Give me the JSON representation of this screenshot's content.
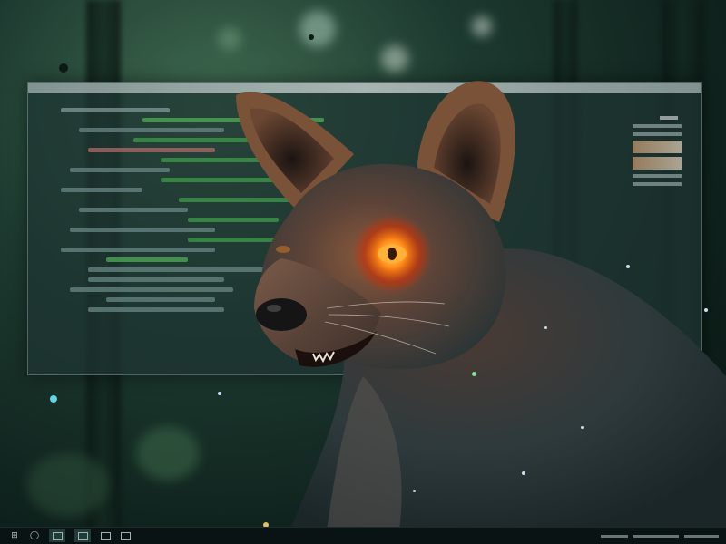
{
  "scene": {
    "subject": "fox",
    "eye_color": "#ff7a10",
    "background_color": "#1d3a30",
    "window_tint": "#1e3432"
  },
  "code_window": {
    "icon": "code-editor-icon"
  },
  "taskbar": {
    "icons": [
      "start-icon",
      "search-icon",
      "task-view-icon",
      "file-explorer-icon",
      "terminal-icon",
      "app-window-icon"
    ]
  }
}
